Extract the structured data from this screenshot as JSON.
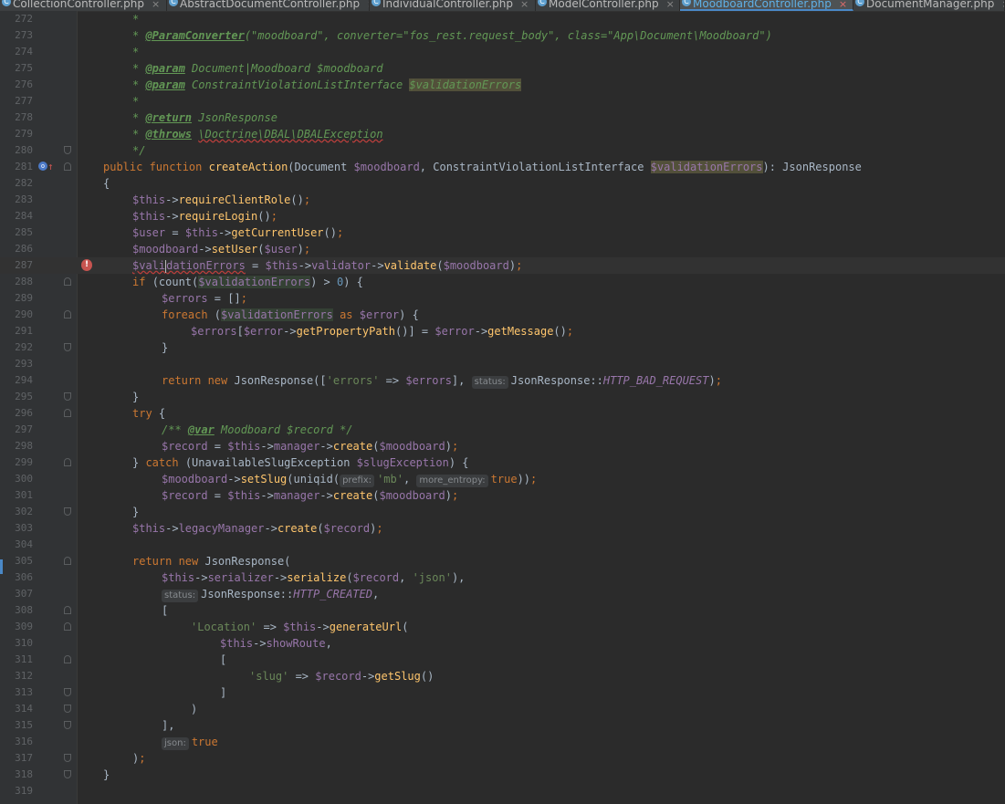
{
  "tabs": [
    {
      "name": "CollectionController.php",
      "icon": "php-class-icon",
      "active": false
    },
    {
      "name": "AbstractDocumentController.php",
      "icon": "php-class-icon",
      "active": false
    },
    {
      "name": "IndividualController.php",
      "icon": "php-class-icon",
      "active": false
    },
    {
      "name": "ModelController.php",
      "icon": "php-class-icon",
      "active": false
    },
    {
      "name": "MoodboardController.php",
      "icon": "php-class-icon",
      "active": true
    },
    {
      "name": "DocumentManager.php",
      "icon": "php-class-icon",
      "active": false
    }
  ],
  "tab_close_glyph": "×",
  "error_glyph": "!",
  "current_line": 287,
  "lines": [
    {
      "n": 272,
      "indent": 1,
      "t": [
        [
          "c",
          "*"
        ]
      ]
    },
    {
      "n": 273,
      "indent": 1,
      "t": [
        [
          "c",
          "* "
        ],
        [
          "ca",
          "@ParamConverter"
        ],
        [
          "c",
          "(\"moodboard\", converter=\"fos_rest.request_body\", class=\"App\\Document\\Moodboard\")"
        ]
      ]
    },
    {
      "n": 274,
      "indent": 1,
      "t": [
        [
          "c",
          "*"
        ]
      ]
    },
    {
      "n": 275,
      "indent": 1,
      "t": [
        [
          "c",
          "* "
        ],
        [
          "ca",
          "@param"
        ],
        [
          "c",
          " Document|Moodboard $moodboard"
        ]
      ]
    },
    {
      "n": 276,
      "indent": 1,
      "t": [
        [
          "c",
          "* "
        ],
        [
          "ca",
          "@param"
        ],
        [
          "c",
          " ConstraintViolationListInterface "
        ],
        [
          "c hlw",
          "$validationErrors"
        ]
      ]
    },
    {
      "n": 277,
      "indent": 1,
      "t": [
        [
          "c",
          "*"
        ]
      ]
    },
    {
      "n": 278,
      "indent": 1,
      "t": [
        [
          "c",
          "* "
        ],
        [
          "ca",
          "@return"
        ],
        [
          "c",
          " JsonResponse"
        ]
      ]
    },
    {
      "n": 279,
      "indent": 1,
      "t": [
        [
          "c",
          "* "
        ],
        [
          "ca",
          "@throws"
        ],
        [
          "c",
          " "
        ],
        [
          "c sq",
          "\\Doctrine\\DBAL\\DBALException"
        ]
      ]
    },
    {
      "n": 280,
      "indent": 1,
      "t": [
        [
          "c",
          "*/"
        ]
      ],
      "fold": "end"
    },
    {
      "n": 281,
      "indent": 0,
      "t": [
        [
          "k",
          "public function "
        ],
        [
          "f",
          "createAction"
        ],
        [
          "t",
          "(Document "
        ],
        [
          "v",
          "$moodboard"
        ],
        [
          "t",
          ", ConstraintViolationListInterface "
        ],
        [
          "v hlw",
          "$validationErrors"
        ],
        [
          "t",
          "): JsonResponse"
        ]
      ],
      "fold": "start",
      "override": true
    },
    {
      "n": 282,
      "indent": 0,
      "t": [
        [
          "t",
          "{"
        ]
      ]
    },
    {
      "n": 283,
      "indent": 1,
      "t": [
        [
          "v",
          "$this"
        ],
        [
          "t",
          "->"
        ],
        [
          "f",
          "requireClientRole"
        ],
        [
          "t",
          "()"
        ],
        [
          "k",
          ";"
        ]
      ]
    },
    {
      "n": 284,
      "indent": 1,
      "t": [
        [
          "v",
          "$this"
        ],
        [
          "t",
          "->"
        ],
        [
          "f",
          "requireLogin"
        ],
        [
          "t",
          "()"
        ],
        [
          "k",
          ";"
        ]
      ]
    },
    {
      "n": 285,
      "indent": 1,
      "t": [
        [
          "v",
          "$user"
        ],
        [
          "t",
          " = "
        ],
        [
          "v",
          "$this"
        ],
        [
          "t",
          "->"
        ],
        [
          "f",
          "getCurrentUser"
        ],
        [
          "t",
          "()"
        ],
        [
          "k",
          ";"
        ]
      ]
    },
    {
      "n": 286,
      "indent": 1,
      "t": [
        [
          "v",
          "$moodboard"
        ],
        [
          "t",
          "->"
        ],
        [
          "f",
          "setUser"
        ],
        [
          "t",
          "("
        ],
        [
          "v",
          "$user"
        ],
        [
          "t",
          ")"
        ],
        [
          "k",
          ";"
        ]
      ]
    },
    {
      "n": 287,
      "indent": 1,
      "t": [
        [
          "v sq",
          "$vali"
        ],
        [
          "caret",
          ""
        ],
        [
          "v sq",
          "dationErrors"
        ],
        [
          "t",
          " = "
        ],
        [
          "v",
          "$this"
        ],
        [
          "t",
          "->"
        ],
        [
          "v",
          "validator"
        ],
        [
          "t",
          "->"
        ],
        [
          "f",
          "validate"
        ],
        [
          "t",
          "("
        ],
        [
          "v",
          "$moodboard"
        ],
        [
          "t",
          ")"
        ],
        [
          "k",
          ";"
        ]
      ],
      "error": true
    },
    {
      "n": 288,
      "indent": 1,
      "t": [
        [
          "k",
          "if "
        ],
        [
          "t",
          "(count("
        ],
        [
          "v hl",
          "$validationErrors"
        ],
        [
          "t",
          ") > "
        ],
        [
          "n",
          "0"
        ],
        [
          "t",
          ") {"
        ]
      ],
      "fold": "start"
    },
    {
      "n": 289,
      "indent": 2,
      "t": [
        [
          "v",
          "$errors"
        ],
        [
          "t",
          " = []"
        ],
        [
          "k",
          ";"
        ]
      ]
    },
    {
      "n": 290,
      "indent": 2,
      "t": [
        [
          "k",
          "foreach "
        ],
        [
          "t",
          "("
        ],
        [
          "v hl",
          "$validationErrors"
        ],
        [
          "k",
          " as "
        ],
        [
          "v",
          "$error"
        ],
        [
          "t",
          ") {"
        ]
      ],
      "fold": "start"
    },
    {
      "n": 291,
      "indent": 3,
      "t": [
        [
          "v",
          "$errors"
        ],
        [
          "t",
          "["
        ],
        [
          "v",
          "$error"
        ],
        [
          "t",
          "->"
        ],
        [
          "f",
          "getPropertyPath"
        ],
        [
          "t",
          "()] = "
        ],
        [
          "v",
          "$error"
        ],
        [
          "t",
          "->"
        ],
        [
          "f",
          "getMessage"
        ],
        [
          "t",
          "()"
        ],
        [
          "k",
          ";"
        ]
      ]
    },
    {
      "n": 292,
      "indent": 2,
      "t": [
        [
          "t",
          "}"
        ]
      ],
      "fold": "end"
    },
    {
      "n": 293,
      "indent": 0,
      "t": []
    },
    {
      "n": 294,
      "indent": 2,
      "t": [
        [
          "k",
          "return new "
        ],
        [
          "t",
          "JsonResponse(["
        ],
        [
          "s",
          "'errors'"
        ],
        [
          "t",
          " => "
        ],
        [
          "v",
          "$errors"
        ],
        [
          "t",
          "], "
        ],
        [
          "hint",
          "status:"
        ],
        [
          "t",
          "JsonResponse::"
        ],
        [
          "cst",
          "HTTP_BAD_REQUEST"
        ],
        [
          "t",
          ")"
        ],
        [
          "k",
          ";"
        ]
      ]
    },
    {
      "n": 295,
      "indent": 1,
      "t": [
        [
          "t",
          "}"
        ]
      ],
      "fold": "end"
    },
    {
      "n": 296,
      "indent": 1,
      "t": [
        [
          "k",
          "try "
        ],
        [
          "t",
          "{"
        ]
      ],
      "fold": "start"
    },
    {
      "n": 297,
      "indent": 2,
      "t": [
        [
          "c",
          "/** "
        ],
        [
          "ca",
          "@var"
        ],
        [
          "c",
          " Moodboard $record */"
        ]
      ]
    },
    {
      "n": 298,
      "indent": 2,
      "t": [
        [
          "v",
          "$record"
        ],
        [
          "t",
          " = "
        ],
        [
          "v",
          "$this"
        ],
        [
          "t",
          "->"
        ],
        [
          "v",
          "manager"
        ],
        [
          "t",
          "->"
        ],
        [
          "f",
          "create"
        ],
        [
          "t",
          "("
        ],
        [
          "v",
          "$moodboard"
        ],
        [
          "t",
          ")"
        ],
        [
          "k",
          ";"
        ]
      ]
    },
    {
      "n": 299,
      "indent": 1,
      "t": [
        [
          "t",
          "} "
        ],
        [
          "k",
          "catch "
        ],
        [
          "t",
          "(UnavailableSlugException "
        ],
        [
          "v",
          "$slugException"
        ],
        [
          "t",
          ") {"
        ]
      ],
      "fold": "start"
    },
    {
      "n": 300,
      "indent": 2,
      "t": [
        [
          "v",
          "$moodboard"
        ],
        [
          "t",
          "->"
        ],
        [
          "f",
          "setSlug"
        ],
        [
          "t",
          "(uniqid("
        ],
        [
          "hint",
          "prefix:"
        ],
        [
          "s",
          "'mb'"
        ],
        [
          "t",
          ", "
        ],
        [
          "hint",
          "more_entropy:"
        ],
        [
          "k",
          "true"
        ],
        [
          "t",
          "))"
        ],
        [
          "k",
          ";"
        ]
      ]
    },
    {
      "n": 301,
      "indent": 2,
      "t": [
        [
          "v",
          "$record"
        ],
        [
          "t",
          " = "
        ],
        [
          "v",
          "$this"
        ],
        [
          "t",
          "->"
        ],
        [
          "v",
          "manager"
        ],
        [
          "t",
          "->"
        ],
        [
          "f",
          "create"
        ],
        [
          "t",
          "("
        ],
        [
          "v",
          "$moodboard"
        ],
        [
          "t",
          ")"
        ],
        [
          "k",
          ";"
        ]
      ]
    },
    {
      "n": 302,
      "indent": 1,
      "t": [
        [
          "t",
          "}"
        ]
      ],
      "fold": "end"
    },
    {
      "n": 303,
      "indent": 1,
      "t": [
        [
          "v",
          "$this"
        ],
        [
          "t",
          "->"
        ],
        [
          "v",
          "legacyManager"
        ],
        [
          "t",
          "->"
        ],
        [
          "f",
          "create"
        ],
        [
          "t",
          "("
        ],
        [
          "v",
          "$record"
        ],
        [
          "t",
          ")"
        ],
        [
          "k",
          ";"
        ]
      ]
    },
    {
      "n": 304,
      "indent": 0,
      "t": []
    },
    {
      "n": 305,
      "indent": 1,
      "t": [
        [
          "k",
          "return new "
        ],
        [
          "t",
          "JsonResponse("
        ]
      ],
      "fold": "start"
    },
    {
      "n": 306,
      "indent": 2,
      "t": [
        [
          "v",
          "$this"
        ],
        [
          "t",
          "->"
        ],
        [
          "v",
          "serializer"
        ],
        [
          "t",
          "->"
        ],
        [
          "f",
          "serialize"
        ],
        [
          "t",
          "("
        ],
        [
          "v",
          "$record"
        ],
        [
          "t",
          ", "
        ],
        [
          "s",
          "'json'"
        ],
        [
          "t",
          "),"
        ]
      ]
    },
    {
      "n": 307,
      "indent": 2,
      "t": [
        [
          "hint",
          "status:"
        ],
        [
          "t",
          "JsonResponse::"
        ],
        [
          "cst",
          "HTTP_CREATED"
        ],
        [
          "t",
          ","
        ]
      ]
    },
    {
      "n": 308,
      "indent": 2,
      "t": [
        [
          "t",
          "["
        ]
      ],
      "fold": "start"
    },
    {
      "n": 309,
      "indent": 3,
      "t": [
        [
          "s",
          "'Location'"
        ],
        [
          "t",
          " => "
        ],
        [
          "v",
          "$this"
        ],
        [
          "t",
          "->"
        ],
        [
          "f",
          "generateUrl"
        ],
        [
          "t",
          "("
        ]
      ],
      "fold": "start"
    },
    {
      "n": 310,
      "indent": 4,
      "t": [
        [
          "v",
          "$this"
        ],
        [
          "t",
          "->"
        ],
        [
          "v",
          "showRoute"
        ],
        [
          "t",
          ","
        ]
      ]
    },
    {
      "n": 311,
      "indent": 4,
      "t": [
        [
          "t",
          "["
        ]
      ],
      "fold": "start"
    },
    {
      "n": 312,
      "indent": 5,
      "t": [
        [
          "s",
          "'slug'"
        ],
        [
          "t",
          " => "
        ],
        [
          "v",
          "$record"
        ],
        [
          "t",
          "->"
        ],
        [
          "f",
          "getSlug"
        ],
        [
          "t",
          "()"
        ]
      ]
    },
    {
      "n": 313,
      "indent": 4,
      "t": [
        [
          "t",
          "]"
        ]
      ],
      "fold": "end"
    },
    {
      "n": 314,
      "indent": 3,
      "t": [
        [
          "t",
          ")"
        ]
      ],
      "fold": "end"
    },
    {
      "n": 315,
      "indent": 2,
      "t": [
        [
          "t",
          "],"
        ]
      ],
      "fold": "end"
    },
    {
      "n": 316,
      "indent": 2,
      "t": [
        [
          "hint",
          "json:"
        ],
        [
          "k",
          "true"
        ]
      ]
    },
    {
      "n": 317,
      "indent": 1,
      "t": [
        [
          "t",
          ")"
        ],
        [
          "k",
          ";"
        ]
      ],
      "fold": "end"
    },
    {
      "n": 318,
      "indent": 0,
      "t": [
        [
          "t",
          "}"
        ]
      ],
      "fold": "end"
    },
    {
      "n": 319,
      "indent": 0,
      "t": []
    }
  ]
}
